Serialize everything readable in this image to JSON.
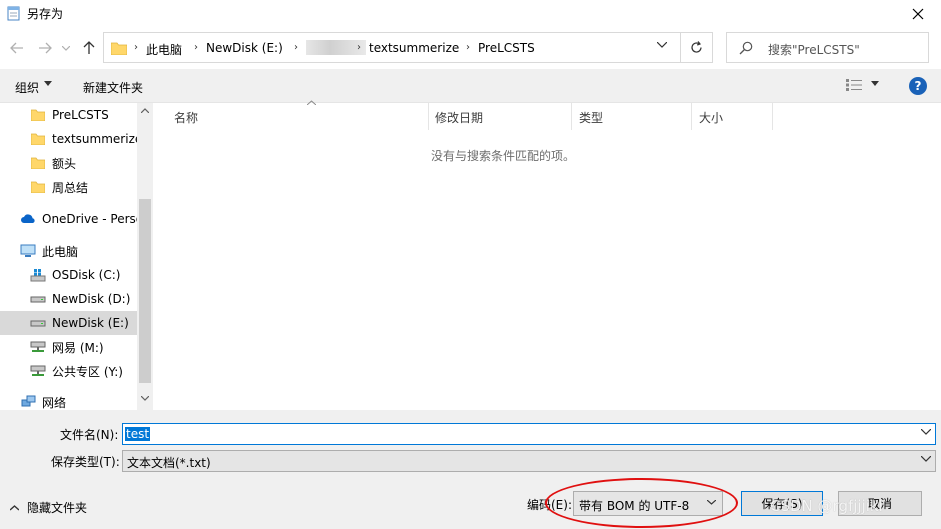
{
  "window": {
    "title": "另存为"
  },
  "nav": {
    "breadcrumbs": [
      "此电脑",
      "NewDisk (E:)",
      "textsummerize",
      "PreLCSTS"
    ],
    "search_placeholder": "搜索\"PreLCSTS\""
  },
  "toolbar": {
    "organize": "组织",
    "new_folder": "新建文件夹",
    "help": "?"
  },
  "sidebar": {
    "items": [
      {
        "label": "PreLCSTS",
        "icon": "folder-icon"
      },
      {
        "label": "textsummerize",
        "icon": "folder-icon"
      },
      {
        "label": "额头",
        "icon": "folder-icon"
      },
      {
        "label": "周总结",
        "icon": "folder-icon"
      },
      {
        "label": "OneDrive - Perso",
        "icon": "onedrive-icon"
      },
      {
        "label": "此电脑",
        "icon": "computer-icon"
      },
      {
        "label": "OSDisk (C:)",
        "icon": "windows-drive-icon"
      },
      {
        "label": "NewDisk (D:)",
        "icon": "drive-icon"
      },
      {
        "label": "NewDisk (E:)",
        "icon": "drive-icon"
      },
      {
        "label": "网易 (M:)",
        "icon": "network-drive-icon"
      },
      {
        "label": "公共专区 (Y:)",
        "icon": "network-drive-icon"
      },
      {
        "label": "网络",
        "icon": "network-icon"
      }
    ]
  },
  "columns": [
    "名称",
    "修改日期",
    "类型",
    "大小"
  ],
  "empty_message": "没有与搜索条件匹配的项。",
  "form": {
    "filename_label": "文件名(N):",
    "filename_value": "test",
    "filetype_label": "保存类型(T):",
    "filetype_value": "文本文档(*.txt)",
    "hide_folders": "隐藏文件夹",
    "encoding_label": "编码(E):",
    "encoding_value": "带有 BOM 的 UTF-8",
    "save": "保存(S)",
    "cancel": "取消"
  },
  "watermark": "CSDN @rgfjjjikl",
  "colors": {
    "accent": "#0078d7",
    "selected": "#d9d9d9",
    "annotation": "#e01010"
  }
}
